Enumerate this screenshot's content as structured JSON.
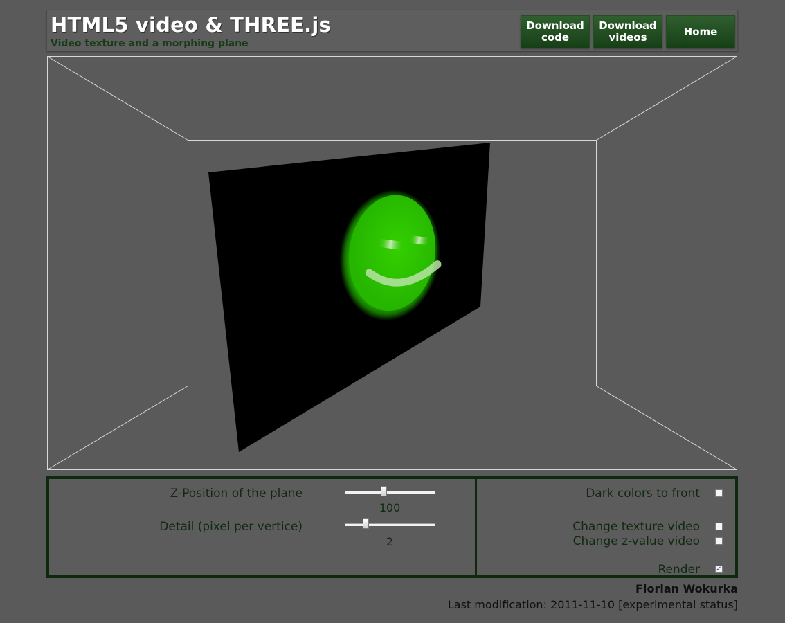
{
  "header": {
    "title": "HTML5 video & THREE.js",
    "subtitle": "Video texture and a morphing plane",
    "buttons": [
      {
        "label": "Download\ncode"
      },
      {
        "label": "Download\nvideos"
      },
      {
        "label": "Home"
      }
    ]
  },
  "scene": {
    "texture_color": "#2ec800",
    "plane_color": "#000000",
    "room_line_color": "#d8d8d8"
  },
  "controls": {
    "z_position": {
      "label": "Z-Position of the plane",
      "value": "100",
      "fraction": 0.42
    },
    "detail": {
      "label": "Detail (pixel per vertice)",
      "value": "2",
      "fraction": 0.21
    },
    "dark_colors": {
      "label": "Dark colors to front",
      "checked": false
    },
    "change_texture": {
      "label": "Change texture video",
      "checked": false
    },
    "change_z": {
      "label": "Change z-value video",
      "checked": false
    },
    "render": {
      "label": "Render",
      "checked": true
    }
  },
  "footer": {
    "author": "Florian Wokurka",
    "last_modification": "Last modification: 2011-11-10 [experimental status]"
  },
  "colors": {
    "background": "#5a5a5a",
    "accent_green": "#173f17",
    "panel_border": "#0e2a0e"
  }
}
